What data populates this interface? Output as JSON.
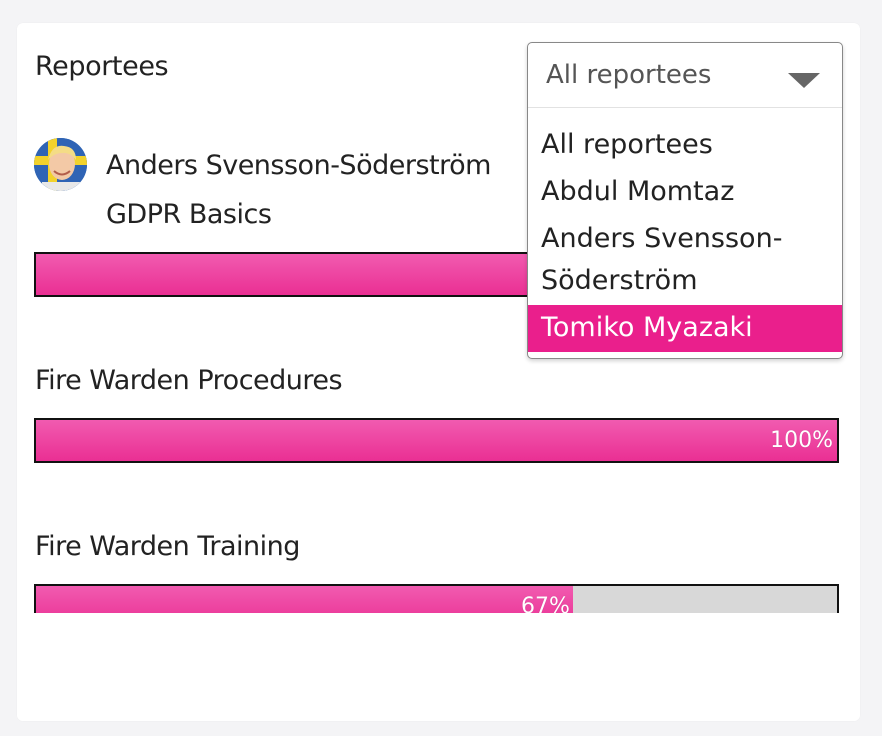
{
  "header": {
    "title": "Reportees"
  },
  "dropdown": {
    "selected_value": "All reportees",
    "options": [
      "All reportees",
      "Abdul Momtaz",
      "Anders Svensson-Söderström",
      "Tomiko Myazaki"
    ],
    "highlighted_option": "Tomiko Myazaki"
  },
  "person": {
    "name": "Anders Svensson-Söderström",
    "avatar": "avatar-photo"
  },
  "courses": [
    {
      "title": "GDPR Basics",
      "progress_percent": null,
      "progress_label": ""
    },
    {
      "title": "Fire Warden Procedures",
      "progress_percent": 100,
      "progress_label": "100%"
    },
    {
      "title": "Fire Warden Training",
      "progress_percent": 67,
      "progress_label": "67%"
    }
  ],
  "colors": {
    "accent": "#ea1f8c",
    "progress_fill": "#ee3d9e",
    "progress_track": "#d8d8d8"
  }
}
